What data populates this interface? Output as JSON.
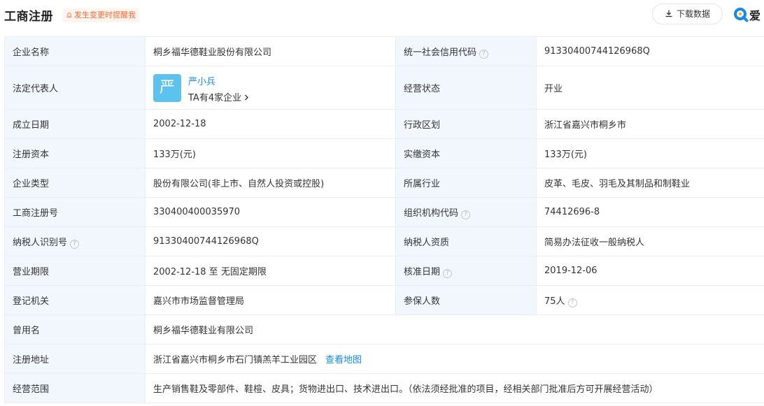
{
  "header": {
    "title": "工商注册",
    "remind": "发生变更时提醒我",
    "download": "下载数据",
    "brand": "爱"
  },
  "company": {
    "name_label": "企业名称",
    "name": "桐乡福华德鞋业股份有限公司",
    "credit_code_label": "统一社会信用代码",
    "credit_code": "91330400744126968Q",
    "legal_rep_label": "法定代表人",
    "legal_rep_avatar": "严",
    "legal_rep_name": "严小兵",
    "legal_rep_sub": "TA有4家企业",
    "status_label": "经营状态",
    "status": "开业",
    "founded_label": "成立日期",
    "founded": "2002-12-18",
    "region_label": "行政区划",
    "region": "浙江省嘉兴市桐乡市",
    "reg_capital_label": "注册资本",
    "reg_capital": "133万(元)",
    "paid_capital_label": "实缴资本",
    "paid_capital": "133万(元)",
    "type_label": "企业类型",
    "type": "股份有限公司(非上市、自然人投资或控股)",
    "industry_label": "所属行业",
    "industry": "皮革、毛皮、羽毛及其制品和制鞋业",
    "reg_no_label": "工商注册号",
    "reg_no": "330400400035970",
    "org_code_label": "组织机构代码",
    "org_code": "74412696-8",
    "taxpayer_id_label": "纳税人识别号",
    "taxpayer_id": "91330400744126968Q",
    "taxpayer_qual_label": "纳税人资质",
    "taxpayer_qual": "简易办法征收一般纳税人",
    "term_label": "营业期限",
    "term": "2002-12-18 至 无固定期限",
    "approved_label": "核准日期",
    "approved": "2019-12-06",
    "authority_label": "登记机关",
    "authority": "嘉兴市市场监督管理局",
    "insured_label": "参保人数",
    "insured": "75人",
    "former_name_label": "曾用名",
    "former_name": "桐乡福华德鞋业有限公司",
    "address_label": "注册地址",
    "address": "浙江省嘉兴市桐乡市石门镇羔羊工业园区",
    "map_link": "查看地图",
    "scope_label": "经营范围",
    "scope": "生产销售鞋及零部件、鞋楦、皮具；货物进出口、技术进出口。（依法须经批准的项目，经相关部门批准后方可开展经营活动）"
  },
  "icons": {
    "help": "?"
  },
  "colors": {
    "label_bg": "#f2f7fe",
    "border": "#e9eef5",
    "link": "#128bed",
    "remind": "#ff6a35",
    "avatar": "#5cc2ee"
  }
}
